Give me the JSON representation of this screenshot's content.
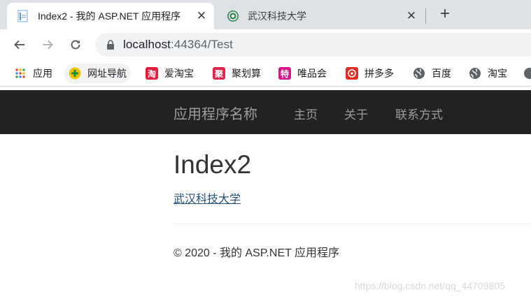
{
  "browser": {
    "tabs": [
      {
        "title": "Index2 - 我的 ASP.NET 应用程序",
        "active": true,
        "close": "✕"
      },
      {
        "title": "武汉科技大学",
        "active": false,
        "close": "✕"
      }
    ],
    "new_tab": "+",
    "url": {
      "host": "localhost",
      "rest": ":44364/Test"
    },
    "bookmarks": [
      {
        "label": "应用",
        "icon": "apps-grid-icon"
      },
      {
        "label": "网址导航",
        "icon": "navigation-plus-icon"
      },
      {
        "label": "爱淘宝",
        "icon": "aitaobao-icon",
        "glyph": "淘"
      },
      {
        "label": "聚划算",
        "icon": "juhuasuan-icon",
        "glyph": "聚"
      },
      {
        "label": "唯品会",
        "icon": "vipshop-icon",
        "glyph": "特"
      },
      {
        "label": "拼多多",
        "icon": "pinduoduo-icon"
      },
      {
        "label": "百度",
        "icon": "globe-icon"
      },
      {
        "label": "淘宝",
        "icon": "globe-icon"
      }
    ]
  },
  "site": {
    "brand": "应用程序名称",
    "nav": [
      "主页",
      "关于",
      "联系方式"
    ]
  },
  "content": {
    "heading": "Index2",
    "link": "武汉科技大学",
    "footer": "© 2020 - 我的 ASP.NET 应用程序"
  },
  "watermark": "https://blog.csdn.net/qq_44709805",
  "colors": {
    "tabstrip": "#dee1e6",
    "navbar": "#222222",
    "nav_text": "#9d9d9d",
    "link": "#23527c"
  }
}
